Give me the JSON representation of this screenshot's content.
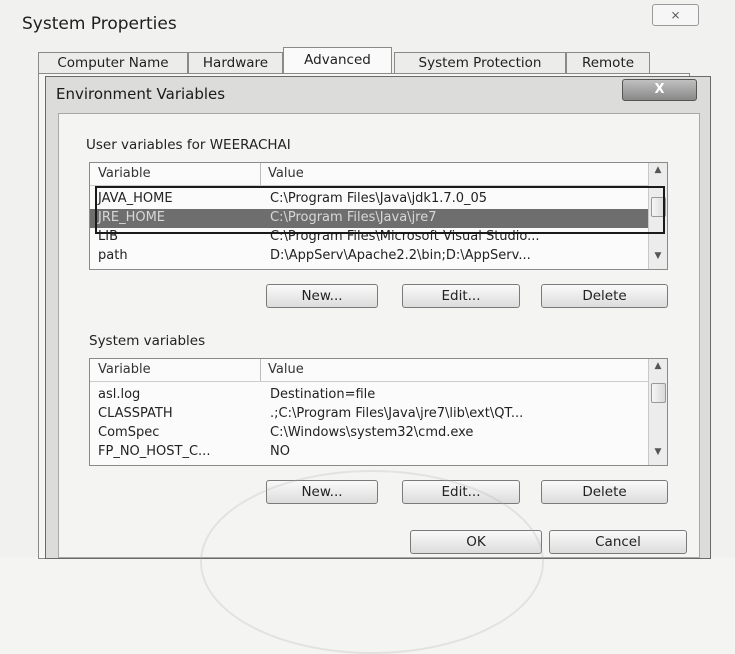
{
  "outer": {
    "title": "System Properties",
    "close_glyph": "⨯",
    "tabs": [
      {
        "label": "Computer Name",
        "active": false
      },
      {
        "label": "Hardware",
        "active": false
      },
      {
        "label": "Advanced",
        "active": true
      },
      {
        "label": "System Protection",
        "active": false
      },
      {
        "label": "Remote",
        "active": false
      }
    ]
  },
  "dialog": {
    "title": "Environment Variables",
    "close_glyph": "X",
    "user_vars": {
      "label": "User variables for WEERACHAI",
      "columns": [
        "Variable",
        "Value"
      ],
      "rows": [
        {
          "variable": "JAVA_HOME",
          "value": "C:\\Program Files\\Java\\jdk1.7.0_05"
        },
        {
          "variable": "JRE_HOME",
          "value": "C:\\Program Files\\Java\\jre7"
        },
        {
          "variable": "LIB",
          "value": "C:\\Program Files\\Microsoft Visual Studio..."
        },
        {
          "variable": "path",
          "value": "D:\\AppServ\\Apache2.2\\bin;D:\\AppServ..."
        }
      ],
      "selected_index": 1,
      "buttons": {
        "new": "New...",
        "edit": "Edit...",
        "delete": "Delete"
      }
    },
    "system_vars": {
      "label": "System variables",
      "columns": [
        "Variable",
        "Value"
      ],
      "rows": [
        {
          "variable": "asl.log",
          "value": "Destination=file"
        },
        {
          "variable": "CLASSPATH",
          "value": ".;C:\\Program Files\\Java\\jre7\\lib\\ext\\QT..."
        },
        {
          "variable": "ComSpec",
          "value": "C:\\Windows\\system32\\cmd.exe"
        },
        {
          "variable": "FP_NO_HOST_C...",
          "value": "NO"
        }
      ],
      "buttons": {
        "new": "New...",
        "edit": "Edit...",
        "delete": "Delete"
      }
    },
    "ok_label": "OK",
    "cancel_label": "Cancel",
    "scroll_up_glyph": "▲",
    "scroll_down_glyph": "▼"
  }
}
